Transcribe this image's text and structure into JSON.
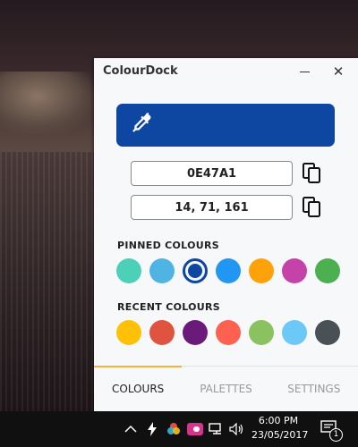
{
  "window": {
    "title": "ColourDock",
    "close_glyph": "✕"
  },
  "picker": {
    "color": "#0E47A1",
    "icon": "eyedropper-icon"
  },
  "values": {
    "hex": "0E47A1",
    "rgb": "14, 71, 161"
  },
  "pinned": {
    "heading": "PINNED COLOURS",
    "colors": [
      "#4DD0B8",
      "#4FB3E3",
      "#0E47A1",
      "#2196F3",
      "#FFA20A",
      "#C543A8",
      "#4CAF50"
    ],
    "selected_index": 2
  },
  "recent": {
    "heading": "RECENT COLOURS",
    "colors": [
      "#FFC107",
      "#E0533E",
      "#6A1B7A",
      "#FF6150",
      "#8BC260",
      "#6CC8F7",
      "#4A5156"
    ]
  },
  "tabs": [
    {
      "label": "COLOURS",
      "active": true
    },
    {
      "label": "PALETTES",
      "active": false
    },
    {
      "label": "SETTINGS",
      "active": false
    }
  ],
  "taskbar": {
    "time": "6:00 PM",
    "date": "23/05/2017",
    "notification_count": "1"
  }
}
